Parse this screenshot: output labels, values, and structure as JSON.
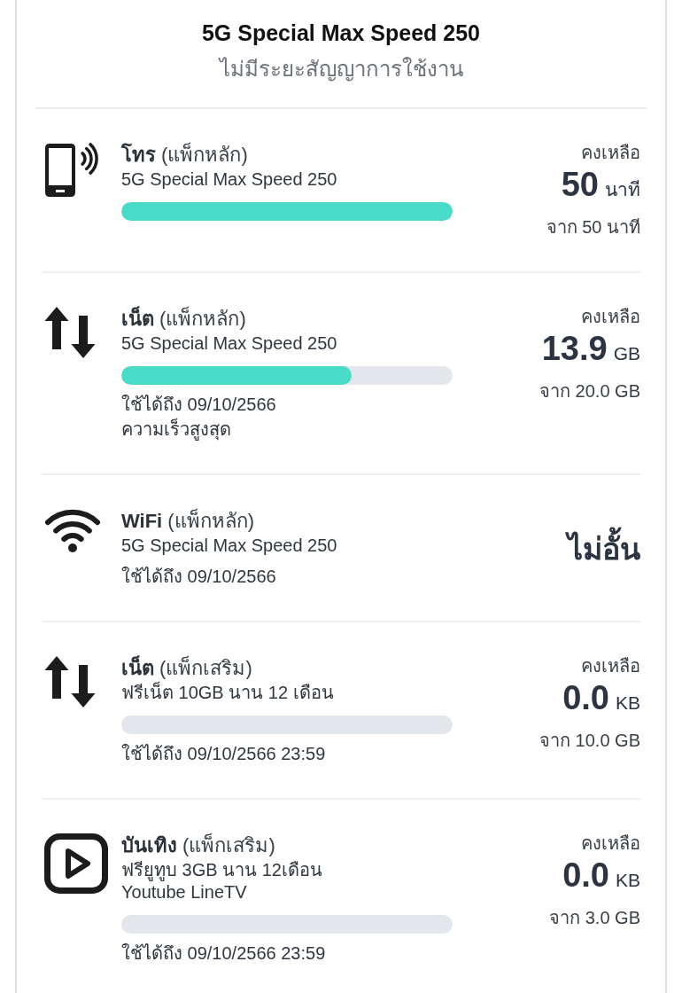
{
  "header": {
    "title": "5G Special Max Speed 250",
    "subtitle": "ไม่มีระยะสัญญาการใช้งาน"
  },
  "packages": [
    {
      "kind": "call",
      "title": "**โทร** (แพ็กหลัก)",
      "lines": [
        "5G Special Max Speed 250"
      ],
      "level": 1,
      "remaining": {
        "label": "คงเหลือ",
        "value": "50",
        "unit": "นาที",
        "total": "จาก 50 นาที"
      }
    },
    {
      "kind": "data",
      "title": "**เน็ต** (แพ็กหลัก)",
      "lines": [
        "5G Special Max Speed 250"
      ],
      "level": 0.695,
      "details": [
        "ใช้ได้ถึง 09/10/2566",
        "ความเร็วสูงสุด"
      ],
      "remaining": {
        "label": "คงเหลือ",
        "value": "13.9",
        "unit": "GB",
        "total": "จาก 20.0 GB"
      }
    },
    {
      "kind": "wifi",
      "title": "**WiFi** (แพ็กหลัก)",
      "lines": [
        "5G Special Max Speed 250"
      ],
      "details": [
        "ใช้ได้ถึง 09/10/2566"
      ],
      "quota": "ไม่อั้น"
    },
    {
      "kind": "data",
      "title": "**เน็ต** (แพ็กเสริม)",
      "lines": [
        "ฟรีเน็ต 10GB นาน 12 เดือน"
      ],
      "level": 0,
      "details": [
        "ใช้ได้ถึง 09/10/2566 23:59"
      ],
      "remaining": {
        "label": "คงเหลือ",
        "value": "0.0",
        "unit": "KB",
        "total": "จาก 10.0 GB"
      }
    },
    {
      "kind": "video",
      "title": "**บันเทิง** (แพ็กเสริม)",
      "lines": [
        "ฟรียูทูบ 3GB นาน 12เดือน",
        "Youtube LineTV"
      ],
      "level": 0,
      "details": [
        "ใช้ได้ถึง 09/10/2566 23:59"
      ],
      "remaining": {
        "label": "คงเหลือ",
        "value": "0.0",
        "unit": "KB",
        "total": "จาก 3.0 GB"
      }
    }
  ]
}
